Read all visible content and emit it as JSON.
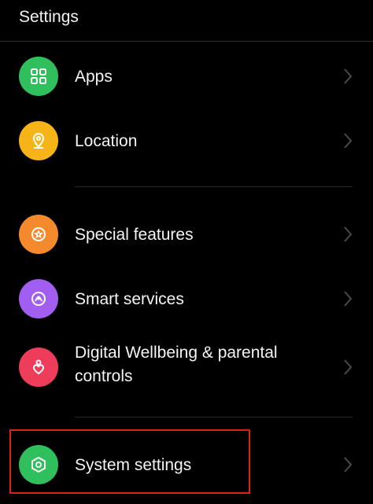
{
  "header": {
    "title": "Settings"
  },
  "colors": {
    "apps": "#2fbf5c",
    "location": "#f6b418",
    "special_features": "#f58a2c",
    "smart_services": "#a25ef0",
    "digital_wellbeing": "#ee3d5a",
    "system_settings": "#2fbf5c",
    "highlight": "#d8231b"
  },
  "items": [
    {
      "label": "Apps",
      "icon": "grid-icon"
    },
    {
      "label": "Location",
      "icon": "location-pin-icon"
    },
    {
      "label": "Special features",
      "icon": "star-icon"
    },
    {
      "label": "Smart services",
      "icon": "smart-services-icon"
    },
    {
      "label": "Digital Wellbeing & parental controls",
      "line1": "Digital Wellbeing & parental",
      "line2": "controls",
      "icon": "heart-person-icon"
    },
    {
      "label": "System settings",
      "icon": "hexagon-settings-icon"
    }
  ]
}
